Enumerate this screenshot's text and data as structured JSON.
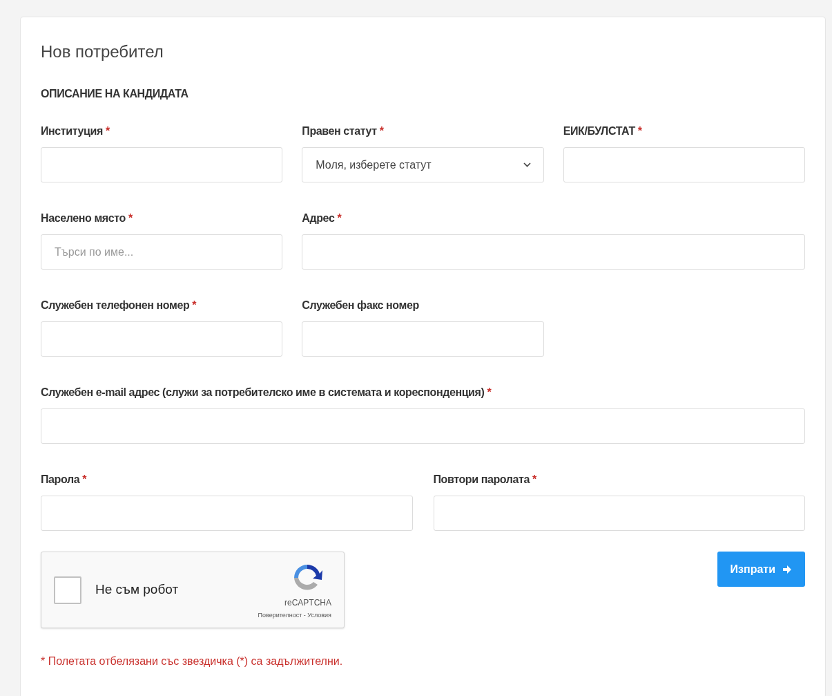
{
  "title": "Нов потребител",
  "section_heading": "ОПИСАНИЕ НА КАНДИДАТА",
  "rows": [
    {
      "fields": [
        {
          "kind": "text",
          "label": "Институция",
          "required_mark": "*"
        },
        {
          "kind": "select",
          "label": "Правен статут",
          "required_mark": "*",
          "value": "Моля, изберете статут"
        },
        {
          "kind": "text",
          "label": "ЕИК/БУЛСТАТ",
          "required_mark": "*"
        }
      ]
    },
    {
      "fields": [
        {
          "kind": "text",
          "label": "Населено място",
          "required_mark": "*",
          "placeholder": "Търси по име..."
        },
        {
          "kind": "text",
          "label": "Адрес",
          "required_mark": "*"
        }
      ]
    },
    {
      "fields": [
        {
          "kind": "text",
          "label": "Служебен телефонен номер",
          "required_mark": "*"
        },
        {
          "kind": "text",
          "label": "Служебен факс номер"
        }
      ]
    },
    {
      "fields": [
        {
          "kind": "text",
          "label": "Служебен e-mail адрес (служи за потребителско име в системата и кореспонденция)",
          "required_mark": "*"
        }
      ]
    },
    {
      "fields": [
        {
          "kind": "password",
          "label": "Парола",
          "required_mark": "*"
        },
        {
          "kind": "password",
          "label": "Повтори паролата",
          "required_mark": "*"
        }
      ]
    }
  ],
  "captcha": {
    "label": "Не съм робот",
    "checked": false,
    "brand": "reCAPTCHA",
    "links": "Поверителност - Условия"
  },
  "submit_button": "Изпрати",
  "footnote": "* Полетата отбелязани със звездичка (*) са задължителни."
}
